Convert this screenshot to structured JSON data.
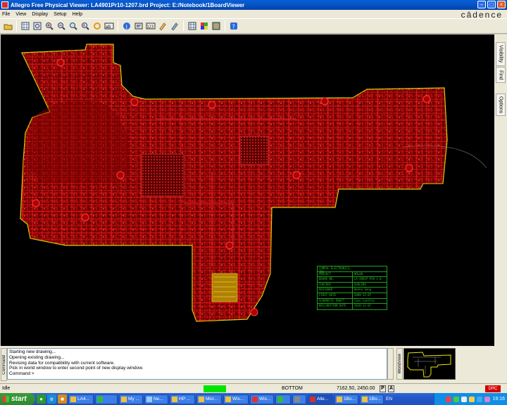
{
  "window": {
    "title": "Allegro Free Physical Viewer: LA4901Pr10-1207.brd  Project: E:/Notebook/1BoardViewer",
    "brand": "cādence"
  },
  "menu": [
    "File",
    "View",
    "Display",
    "Setup",
    "Help"
  ],
  "toolbar": [
    "open-icon",
    "grid-icon",
    "zoom-fit-icon",
    "zoom-in-icon",
    "zoom-out-icon",
    "zoom-world-icon",
    "zoom-previous-icon",
    "redraw-icon",
    "measure-icon",
    "info-icon",
    "show-element-icon",
    "report-icon",
    "highlight-icon",
    "dehighlight-icon",
    "color-icon",
    "layers-icon",
    "palette-icon",
    "help-icon"
  ],
  "side_tabs": [
    "Visibility",
    "Find",
    "Options"
  ],
  "title_block": {
    "rows": [
      [
        "COMPAL ELECTRONICS, INC.",
        ""
      ],
      [
        "PROJECT",
        "HDL00"
      ],
      [
        "BOARD NO.",
        "LA-4901P  PCB  1.0"
      ],
      [
        "CHECKED",
        "GUOLING"
      ],
      [
        "DESIGNER",
        "Wenhu Song"
      ],
      [
        "FIRST DATE",
        "2009-12-07"
      ],
      [
        "SCHEMATIC DRAFT",
        "Conn Leotfun"
      ],
      [
        "DECLARATION DATE",
        "2010-12-07"
      ]
    ]
  },
  "console": {
    "label": "Command",
    "lines": [
      "Starting new drawing...",
      "Opening existing drawing...",
      "Revising data for compatibility with current software.",
      "Pick in world window to enter second point of new display window.",
      "Command >"
    ]
  },
  "worldview_label": "WorldView",
  "status": {
    "state": "Idle",
    "layer": "BOTTOM",
    "coords": "7162.50, 2450.00",
    "p_button": "P",
    "a_button": "A",
    "drc": "DRC"
  },
  "taskbar": {
    "start": "start",
    "tasks": [
      "LA4...",
      "",
      "My ...",
      "Ne...",
      "HP ...",
      "Micr...",
      "Wis...",
      "Wis...",
      "",
      "",
      "Alle...",
      "1Bo...",
      "1Bo..."
    ],
    "language": "EN",
    "clock": "19:16"
  },
  "colors": {
    "board_fill": "#8a0000",
    "trace": "#ff1a1a",
    "outline": "#d9d900",
    "accent_green": "#00e400",
    "drc_red": "#d40000"
  }
}
